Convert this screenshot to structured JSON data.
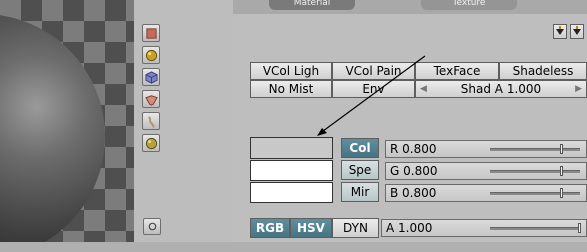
{
  "tabs": [
    "Material",
    "Texture"
  ],
  "toggles_row1": [
    "VCol Ligh",
    "VCol Pain",
    "TexFace",
    "Shadeless"
  ],
  "toggles_row2": {
    "no_mist": "No Mist",
    "env": "Env",
    "shad_alpha": "Shad A 1.000",
    "shad_alpha_value": 1.0
  },
  "channels": [
    "Col",
    "Spe",
    "Mir"
  ],
  "color_swatches": {
    "col": "#c8c8c8",
    "spe": "#ffffff",
    "mir": "#ffffff"
  },
  "sliders": [
    {
      "label": "R 0.800",
      "value": 0.8
    },
    {
      "label": "G 0.800",
      "value": 0.8
    },
    {
      "label": "B 0.800",
      "value": 0.8
    },
    {
      "label": "A 1.000",
      "value": 1.0
    }
  ],
  "color_modes": [
    "RGB",
    "HSV",
    "DYN"
  ],
  "preview_buttons": [
    "plane-preview-icon",
    "sphere-preview-icon",
    "cube-preview-icon",
    "monkey-preview-icon",
    "hair-preview-icon",
    "world-sphere-preview-icon"
  ],
  "accent_colors": {
    "blue_button": "#4f7f8f",
    "panel": "#bebebe"
  }
}
